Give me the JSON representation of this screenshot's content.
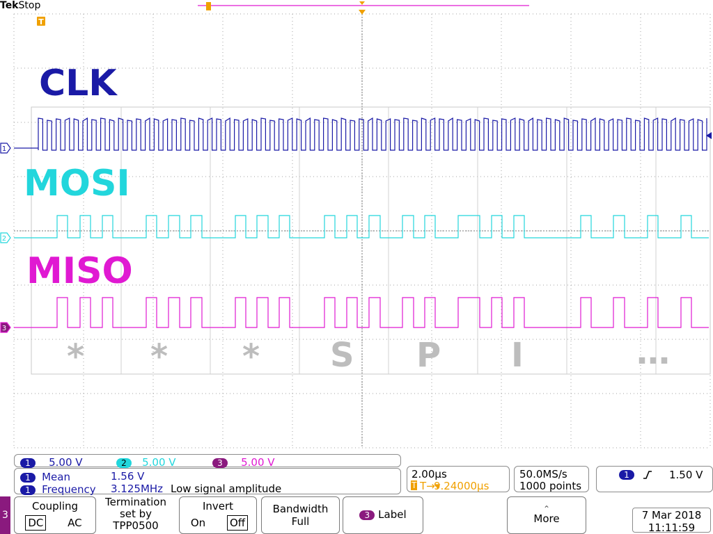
{
  "brand": {
    "logo": "Tek",
    "state": "Stop"
  },
  "colors": {
    "ch1": "#1a1aa6",
    "ch2": "#22d6dc",
    "ch3": "#e019d2",
    "trigger": "#f0a000",
    "deco": "#bdbdbd",
    "grid": "#a0a0a0"
  },
  "channels": [
    {
      "num": "1",
      "label": "CLK",
      "scale": "5.00 V",
      "color": "#1a1aa6"
    },
    {
      "num": "2",
      "label": "MOSI",
      "scale": "5.00 V",
      "color": "#22d6dc"
    },
    {
      "num": "3",
      "label": "MISO",
      "scale": "5.00 V",
      "color": "#e019d2"
    }
  ],
  "trigger_marker": "T",
  "decoded_chars": [
    "*",
    "*",
    "*",
    "S",
    "P",
    "I",
    "…"
  ],
  "measurements": [
    {
      "ch": "1",
      "name": "Mean",
      "value": "1.56 V",
      "note": ""
    },
    {
      "ch": "1",
      "name": "Frequency",
      "value": "3.125MHz",
      "note": "Low signal amplitude"
    }
  ],
  "timebase": {
    "scale": "2.00µs",
    "delay": "9.24000µs",
    "delay_marker": "T→▾"
  },
  "acquisition": {
    "rate": "50.0MS/s",
    "points": "1000 points"
  },
  "trigger": {
    "ch": "1",
    "slope": "rising-edge-icon",
    "level": "1.50 V"
  },
  "menu": {
    "channel_tab": "3",
    "coupling": {
      "title": "Coupling",
      "options": [
        "DC",
        "AC"
      ],
      "selected": "DC"
    },
    "termination": {
      "line1": "Termination",
      "line2": "set by",
      "line3": "TPP0500"
    },
    "invert": {
      "title": "Invert",
      "options": [
        "On",
        "Off"
      ],
      "selected": "Off"
    },
    "bandwidth": {
      "title": "Bandwidth",
      "value": "Full"
    },
    "label": {
      "ch": "3",
      "text": "Label"
    },
    "more": {
      "arrow": "⌃",
      "text": "More"
    }
  },
  "datetime": {
    "date": "7 Mar 2018",
    "time": "11:11:59"
  }
}
